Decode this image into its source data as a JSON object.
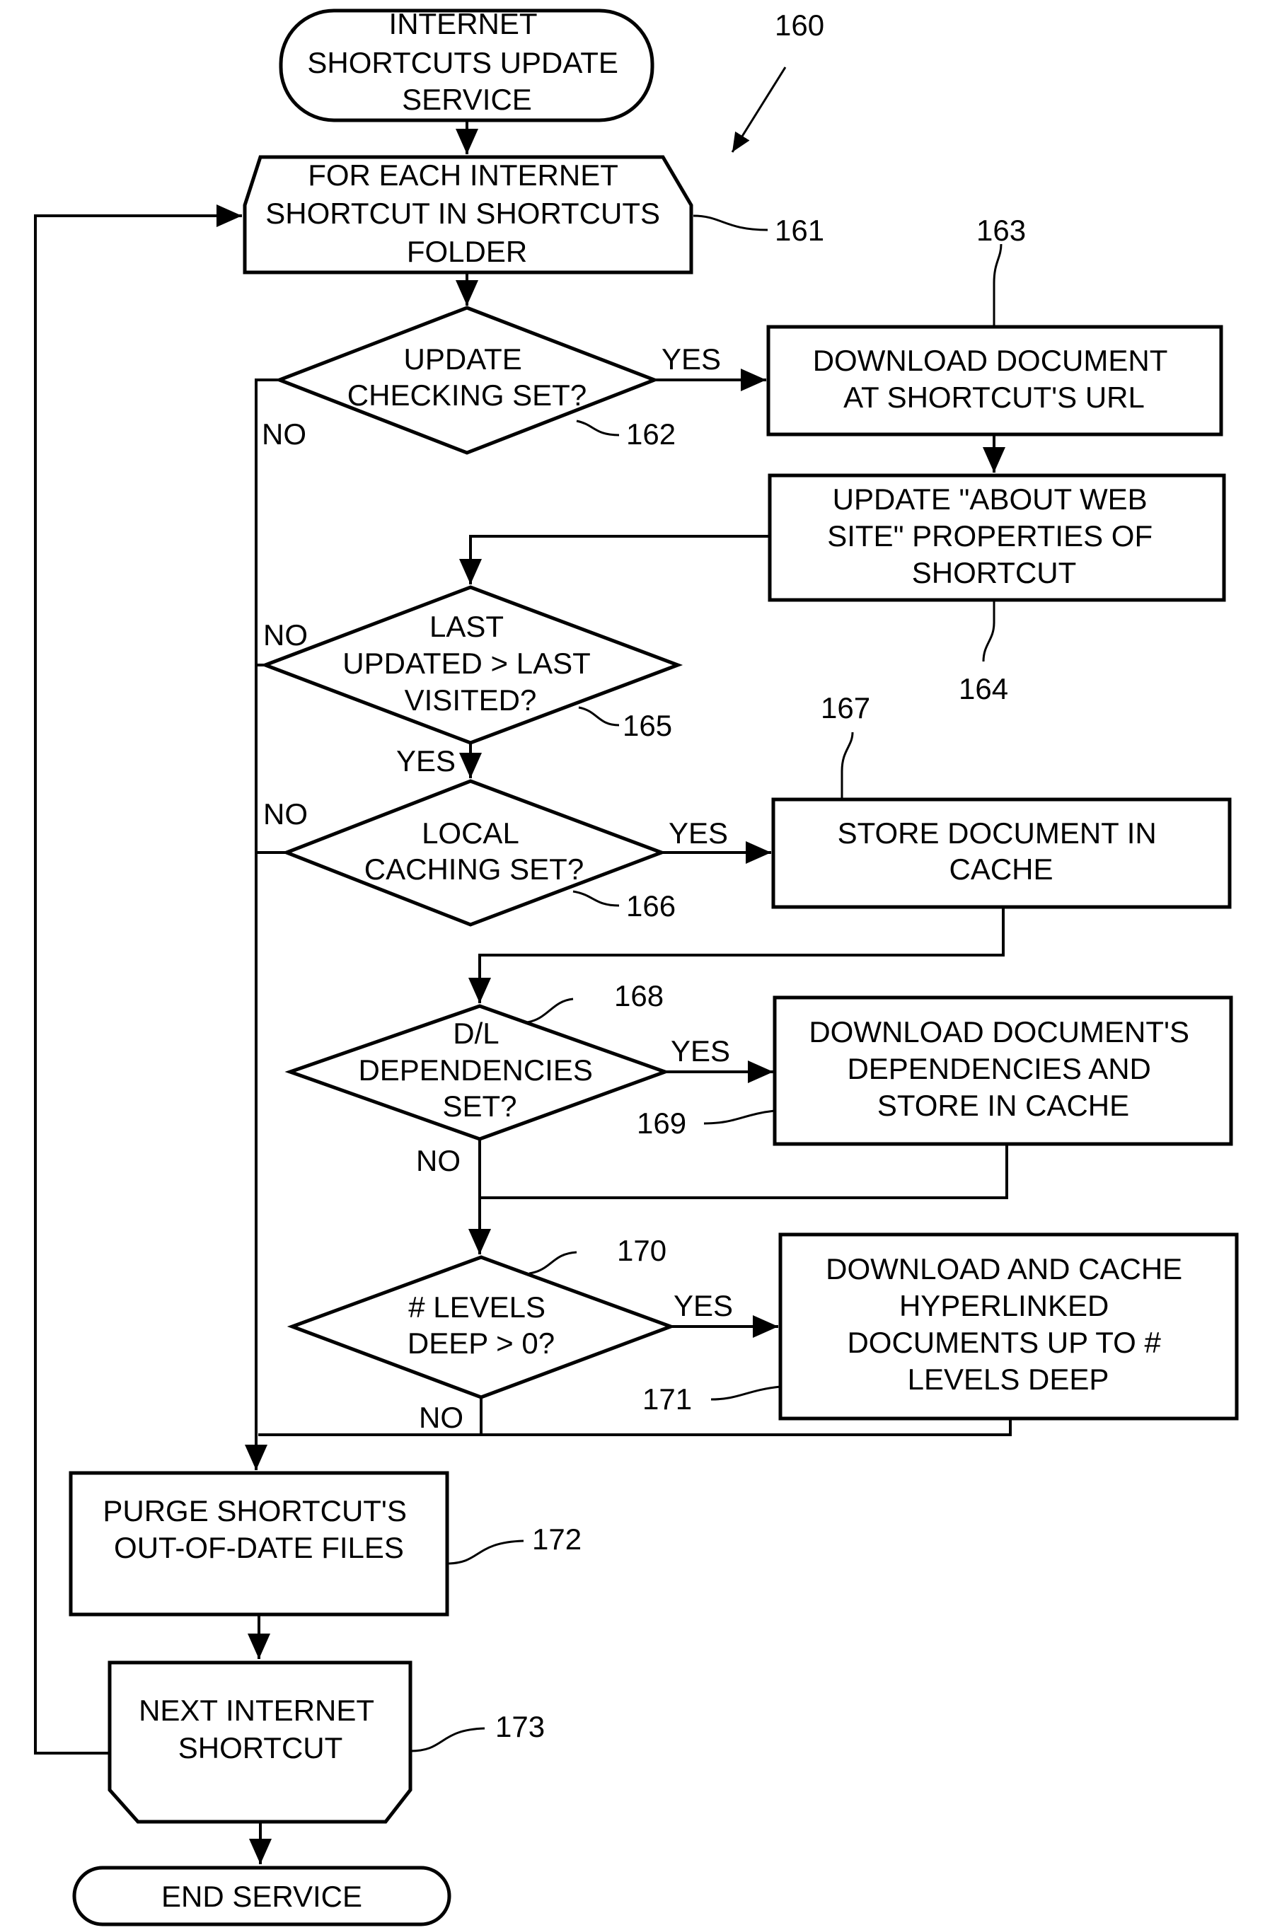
{
  "figure_ref": "160",
  "nodes": {
    "start": {
      "ref": "",
      "lines": [
        "INTERNET",
        "SHORTCUTS UPDATE",
        "SERVICE"
      ]
    },
    "loop_start": {
      "ref": "161",
      "lines": [
        "FOR EACH INTERNET",
        "SHORTCUT IN SHORTCUTS",
        "FOLDER"
      ]
    },
    "d162": {
      "ref": "162",
      "lines": [
        "UPDATE",
        "CHECKING SET?"
      ]
    },
    "p163": {
      "ref": "163",
      "lines": [
        "DOWNLOAD DOCUMENT",
        "AT SHORTCUT'S URL"
      ]
    },
    "p164": {
      "ref": "164",
      "lines": [
        "UPDATE \"ABOUT WEB",
        "SITE\" PROPERTIES OF",
        "SHORTCUT"
      ]
    },
    "d165": {
      "ref": "165",
      "lines": [
        "LAST",
        "UPDATED > LAST",
        "VISITED?"
      ]
    },
    "d166": {
      "ref": "166",
      "lines": [
        "LOCAL",
        "CACHING SET?"
      ]
    },
    "p167": {
      "ref": "167",
      "lines": [
        "STORE DOCUMENT IN",
        "CACHE"
      ]
    },
    "d168": {
      "ref": "168",
      "lines": [
        "D/L",
        "DEPENDENCIES",
        "SET?"
      ]
    },
    "p169": {
      "ref": "169",
      "lines": [
        "DOWNLOAD DOCUMENT'S",
        "DEPENDENCIES AND",
        "STORE IN CACHE"
      ]
    },
    "d170": {
      "ref": "170",
      "lines": [
        "# LEVELS",
        "DEEP > 0?"
      ]
    },
    "p171": {
      "ref": "171",
      "lines": [
        "DOWNLOAD AND CACHE",
        "HYPERLINKED",
        "DOCUMENTS UP TO #",
        "LEVELS DEEP"
      ]
    },
    "p172": {
      "ref": "172",
      "lines": [
        "PURGE SHORTCUT'S",
        "OUT-OF-DATE FILES"
      ]
    },
    "loop_end": {
      "ref": "173",
      "lines": [
        "NEXT INTERNET",
        "SHORTCUT"
      ]
    },
    "end": {
      "ref": "",
      "lines": [
        "END SERVICE"
      ]
    }
  },
  "edge_labels": {
    "yes": "YES",
    "no": "NO"
  }
}
